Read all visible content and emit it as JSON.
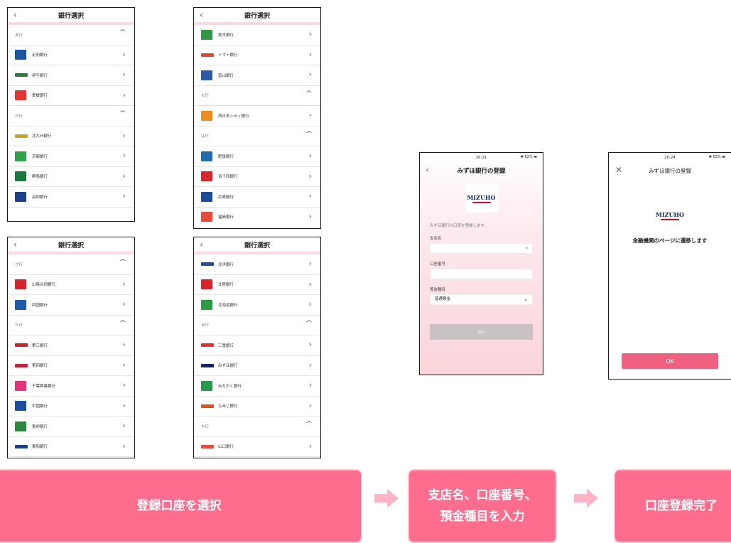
{
  "screens": {
    "a": {
      "title": "銀行選択",
      "rows": [
        {
          "type": "section",
          "label": "あ行"
        },
        {
          "type": "bank",
          "label": "足利銀行",
          "color": "#1b56a3"
        },
        {
          "type": "bank",
          "label": "伊予銀行",
          "color": "#2d7a3e",
          "wide": true
        },
        {
          "type": "bank",
          "label": "愛媛銀行",
          "color": "#e3342f"
        },
        {
          "type": "section",
          "label": "か行"
        },
        {
          "type": "bank",
          "label": "北九州銀行",
          "color": "#c9a52b",
          "wide": true
        },
        {
          "type": "bank",
          "label": "京都銀行",
          "color": "#2fa24a"
        },
        {
          "type": "bank",
          "label": "群馬銀行",
          "color": "#1a7a3c"
        },
        {
          "type": "bank",
          "label": "高知銀行",
          "color": "#1d3f8a"
        }
      ]
    },
    "b": {
      "title": "銀行選択",
      "rows": [
        {
          "type": "bank",
          "label": "栃木銀行",
          "color": "#2e9a46"
        },
        {
          "type": "bank",
          "label": "トマト銀行",
          "color": "#e0452a",
          "wide": true
        },
        {
          "type": "bank",
          "label": "富山銀行",
          "color": "#2a5aa8"
        },
        {
          "type": "section",
          "label": "な行"
        },
        {
          "type": "bank",
          "label": "西日本シティ銀行",
          "color": "#f08a1c"
        },
        {
          "type": "section",
          "label": "は行"
        },
        {
          "type": "bank",
          "label": "肥後銀行",
          "color": "#1e6ab0"
        },
        {
          "type": "bank",
          "label": "百十四銀行",
          "color": "#d9262b"
        },
        {
          "type": "bank",
          "label": "広島銀行",
          "color": "#1b4c9a"
        },
        {
          "type": "bank",
          "label": "福島銀行",
          "color": "#e84a3a"
        }
      ]
    },
    "c": {
      "title": "銀行選択",
      "rows": [
        {
          "type": "section",
          "label": "さ行"
        },
        {
          "type": "bank",
          "label": "山陰合同銀行",
          "color": "#d9232d"
        },
        {
          "type": "bank",
          "label": "四国銀行",
          "color": "#1f5aa6"
        },
        {
          "type": "section",
          "label": "た行"
        },
        {
          "type": "bank",
          "label": "第三銀行",
          "color": "#d4202a",
          "wide": true
        },
        {
          "type": "bank",
          "label": "第四銀行",
          "color": "#c81e3a",
          "wide": true
        },
        {
          "type": "bank",
          "label": "千葉興業銀行",
          "color": "#e5337a"
        },
        {
          "type": "bank",
          "label": "中国銀行",
          "color": "#1c4e9e"
        },
        {
          "type": "bank",
          "label": "東邦銀行",
          "color": "#2a8a3c"
        },
        {
          "type": "bank",
          "label": "東和銀行",
          "color": "#1d3f8a",
          "wide": true
        }
      ]
    },
    "d": {
      "title": "銀行選択",
      "rows": [
        {
          "type": "bank",
          "label": "北洋銀行",
          "color": "#1f4e9a",
          "wide": true
        },
        {
          "type": "bank",
          "label": "北陸銀行",
          "color": "#d9232d"
        },
        {
          "type": "bank",
          "label": "北海道銀行",
          "color": "#2e9a46"
        },
        {
          "type": "section",
          "label": "ま行"
        },
        {
          "type": "bank",
          "label": "三重銀行",
          "color": "#e5332a",
          "wide": true
        },
        {
          "type": "bank",
          "label": "みずほ銀行",
          "color": "#13246b",
          "wide": true
        },
        {
          "type": "bank",
          "label": "みちのく銀行",
          "color": "#2a9a4a"
        },
        {
          "type": "bank",
          "label": "もみじ銀行",
          "color": "#e8501f",
          "wide": true
        },
        {
          "type": "section",
          "label": "や行"
        },
        {
          "type": "bank",
          "label": "山口銀行",
          "color": "#e74c3c",
          "wide": true
        }
      ]
    }
  },
  "form": {
    "time": "20:21",
    "battery": "62%",
    "title": "みずほ銀行の登録",
    "logo": "MIZUHO",
    "intro": "みずほ銀行の口座を登録します。",
    "branch_label": "支店名",
    "account_label": "口座番号",
    "type_label": "預金種目",
    "type_value": "普通預金",
    "next_label": "次へ"
  },
  "done": {
    "time": "20:24",
    "battery": "62%",
    "title": "みずほ銀行の登録",
    "logo": "MIZUHO",
    "message": "金融機関のページに遷移します",
    "ok_label": "OK"
  },
  "steps": {
    "step1": "登録口座を選択",
    "step2_line1": "支店名、口座番号、",
    "step2_line2": "預金種目を入力",
    "step3": "口座登録完了"
  },
  "colors": {
    "banner": "#ff6d8e",
    "arrow": "#ffb3c4",
    "ok": "#f0607f"
  }
}
